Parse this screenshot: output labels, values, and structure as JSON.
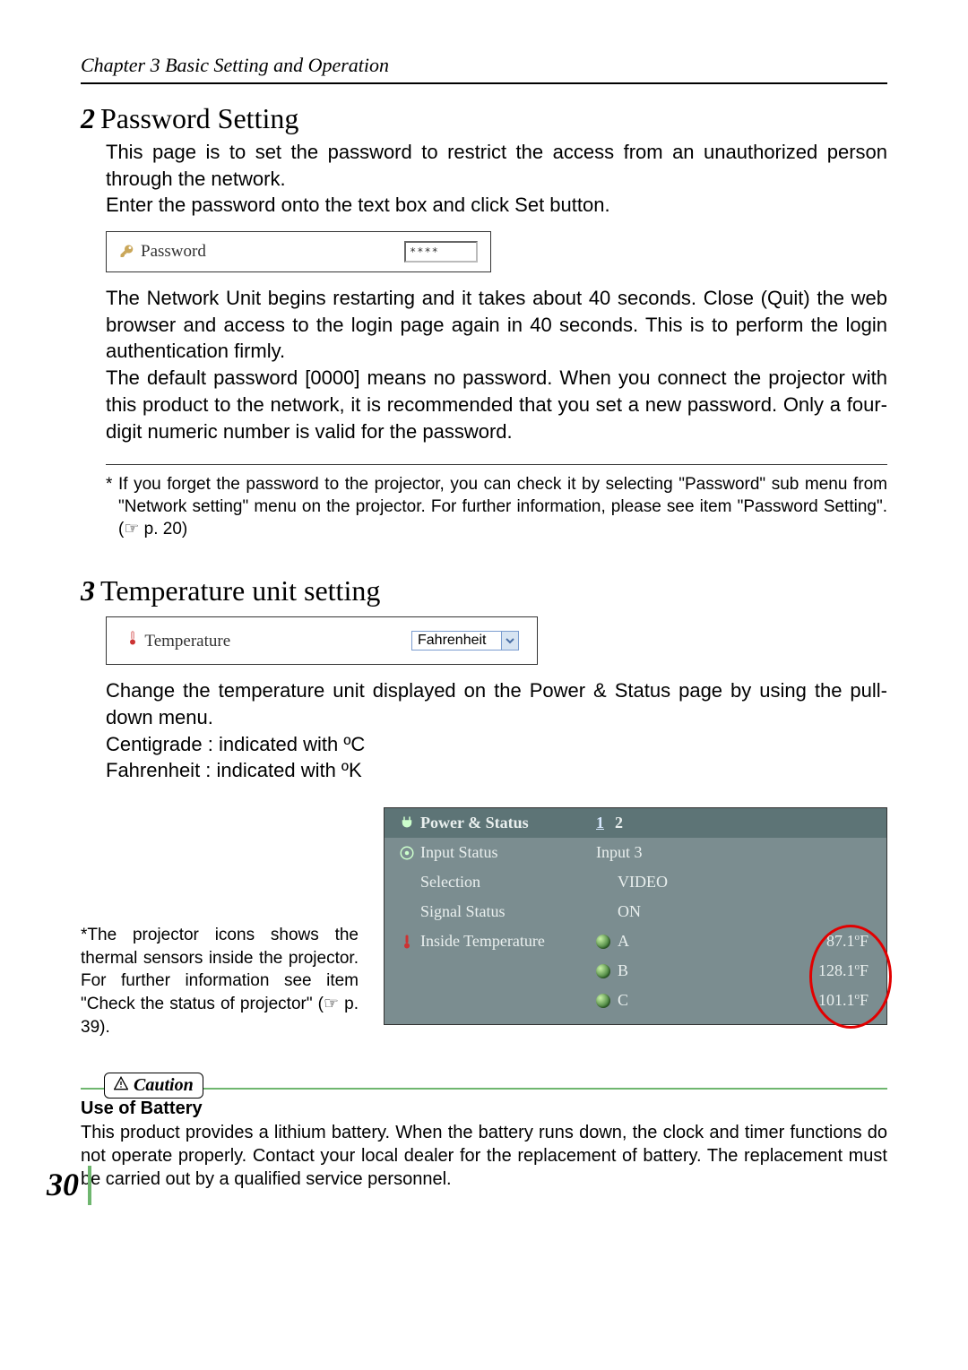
{
  "chapter_header": "Chapter 3 Basic Setting and Operation",
  "section2": {
    "num": "2",
    "title": "Password Setting",
    "intro1": "This page is to set the password to restrict the access from an unauthorized person through the network.",
    "intro2_a": "Enter the password onto the text box and click ",
    "intro2_set": "Set",
    "intro2_b": " button.",
    "inset_label": "Password",
    "inset_value": "****",
    "para2": "The Network Unit begins restarting and it takes about 40 seconds. Close (Quit) the web browser and access to the login page again in 40 seconds. This is to perform the login authentication firmly.",
    "para3": "The default password [0000] means no password.  When you connect the projector with this product to the network, it is recommended that you set a new password. Only a four-digit numeric number is valid for the password.",
    "footnote": "* If you forget the password to the projector, you can check it by selecting \"Password\" sub menu from \"Network setting\" menu on the projector. For further information, please see item \"Password Setting\".(☞ p. 20)"
  },
  "section3": {
    "num": "3",
    "title": "Temperature unit setting",
    "inset_label": "Temperature",
    "select_value": "Fahrenheit",
    "para1": "Change the temperature unit displayed on the Power & Status page by using the pull-down  menu.",
    "para2": "Centigrade : indicated with ºC",
    "para3": "Fahrenheit : indicated with ºK"
  },
  "side_note": "*The projector icons shows the thermal sensors inside the projector. For further information see item \"Check the status of projector\" (☞ p. 39).",
  "status": {
    "head": "Power & Status",
    "page_link": "1",
    "page_other": "2",
    "rows": [
      {
        "label": "Input Status",
        "value": "Input 3"
      },
      {
        "label": "Selection",
        "value": "VIDEO"
      },
      {
        "label": "Signal Status",
        "value": "ON"
      }
    ],
    "temp_label": "Inside Temperature",
    "temps": [
      {
        "name": "A",
        "value": "87.1",
        "unit": "F"
      },
      {
        "name": "B",
        "value": "128.1",
        "unit": "F"
      },
      {
        "name": "C",
        "value": "101.1",
        "unit": "F"
      }
    ]
  },
  "caution": {
    "pill": "Caution",
    "heading": "Use of Battery",
    "body": "This product provides a lithium battery. When the battery runs down, the clock and timer functions do not operate properly. Contact your local dealer for the replacement of battery. The replacement must be carried out by a qualified service personnel."
  },
  "page_number": "30"
}
